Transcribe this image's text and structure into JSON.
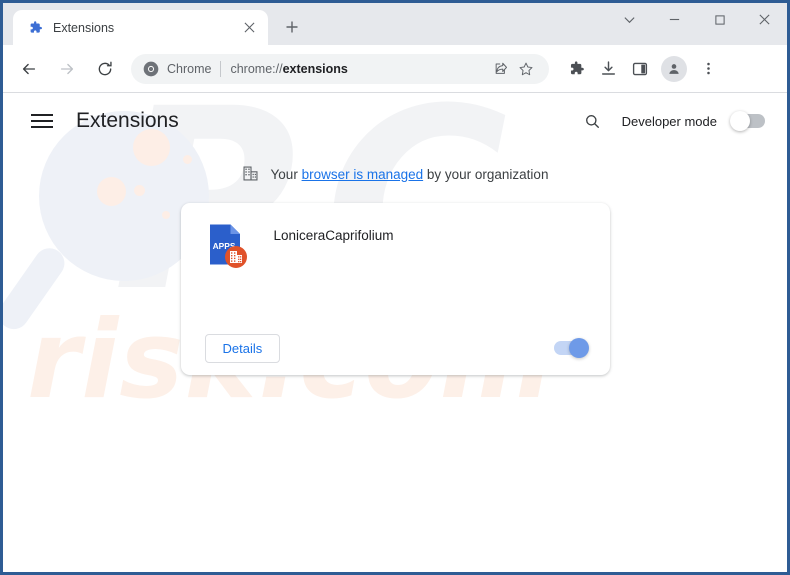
{
  "window": {
    "controls": [
      {
        "name": "tab-search-button",
        "glyph": "chevron-down-icon"
      },
      {
        "name": "minimize-button",
        "glyph": "minimize-icon"
      },
      {
        "name": "maximize-button",
        "glyph": "maximize-icon"
      },
      {
        "name": "close-button",
        "glyph": "close-icon"
      }
    ]
  },
  "tabstrip": {
    "tab": {
      "title": "Extensions",
      "favicon": "puzzle-piece-icon",
      "close_label": "×"
    },
    "new_tab_label": "+"
  },
  "toolbar": {
    "back_label": "←",
    "forward_label": "→",
    "reload_label": "↻",
    "omnibox": {
      "chrome_label": "Chrome",
      "url_prefix": "chrome://",
      "url_emphasis": "extensions",
      "full_url": "chrome://extensions",
      "share_icon": "share-icon",
      "bookmark_icon": "star-icon"
    },
    "icons": [
      {
        "name": "extensions-icon",
        "label": "Extensions"
      },
      {
        "name": "downloads-icon",
        "label": "Downloads"
      },
      {
        "name": "side-panel-icon",
        "label": "Side panel"
      },
      {
        "name": "profile-avatar",
        "label": "Profile"
      },
      {
        "name": "chrome-menu-icon",
        "label": "Customize and control Google Chrome"
      }
    ]
  },
  "page": {
    "menu_icon": "hamburger-menu-icon",
    "title": "Extensions",
    "search_icon": "search-icon",
    "developer_mode": {
      "label": "Developer mode",
      "state": "off"
    },
    "managed_banner": {
      "icon": "enterprise-building-icon",
      "prefix": "Your ",
      "link": "browser is managed",
      "suffix": " by your organization"
    },
    "extension_card": {
      "name": "LoniceraCaprifolium",
      "icon": {
        "name": "apps-document-icon",
        "label": "APPS",
        "badge": "enterprise-building-badge"
      },
      "details_label": "Details",
      "enabled": true
    }
  },
  "watermark": {
    "top_text": "PC",
    "bottom_text": "risk.com"
  },
  "colors": {
    "accent_blue": "#1a73e8",
    "window_border": "#2e5c94",
    "tabstrip_bg": "#e6e8ec",
    "icon_blue": "#2b5fcb",
    "badge_orange": "#e0522a",
    "toggle_on_track": "#c3d5f5",
    "toggle_on_knob": "#6e9ae8",
    "watermark_peach": "#fdf0e8"
  }
}
